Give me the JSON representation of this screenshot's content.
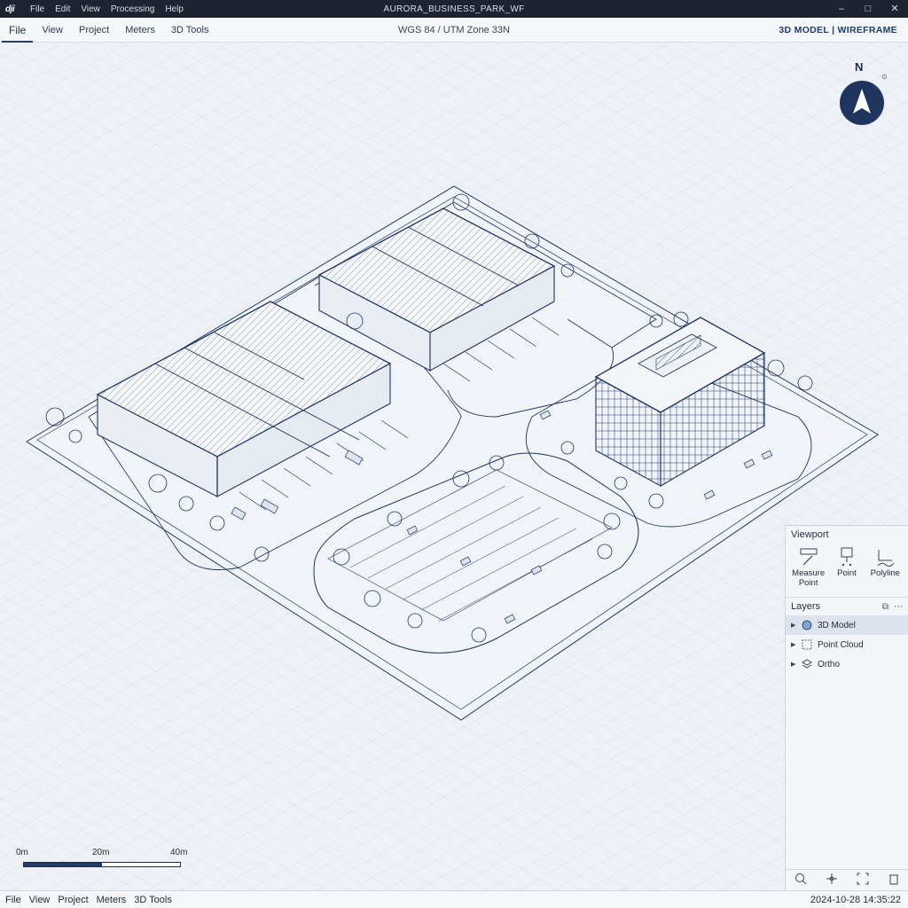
{
  "titlebar": {
    "logo": "dji",
    "menu": [
      "File",
      "Edit",
      "View",
      "Processing",
      "Help"
    ],
    "title": "AURORA_BUSINESS_PARK_WF",
    "controls": [
      "–",
      "□",
      "✕"
    ]
  },
  "toolbar": {
    "tabs": [
      "File",
      "View",
      "Project",
      "Meters",
      "3D Tools"
    ],
    "active_tab": "File",
    "crs": "WGS 84 / UTM Zone 33N",
    "mode": "3D MODEL | WIREFRAME"
  },
  "compass": {
    "north_label": "N",
    "icon": "compass-arrow-icon"
  },
  "scale": {
    "labels": [
      "0m",
      "20m",
      "40m"
    ],
    "fill_fraction": 0.5
  },
  "panel": {
    "viewport_title": "Viewport",
    "tools": [
      {
        "label": "Measure Point",
        "icon": "ruler-pencil-icon"
      },
      {
        "label": "Point",
        "icon": "point-marker-icon"
      },
      {
        "label": "Polyline",
        "icon": "polyline-icon"
      }
    ],
    "layers_title": "Layers",
    "layers": [
      {
        "label": "3D Model",
        "icon": "mesh-icon",
        "selected": true
      },
      {
        "label": "Point Cloud",
        "icon": "point-cloud-icon",
        "selected": false
      },
      {
        "label": "Ortho",
        "icon": "ortho-layers-icon",
        "selected": false
      }
    ],
    "bottom_icons": [
      "zoom-icon",
      "pan-icon",
      "fit-view-icon",
      "delete-icon"
    ]
  },
  "statusbar": {
    "menu": [
      "File",
      "View",
      "Project",
      "Meters",
      "3D Tools"
    ],
    "timestamp": "2024-10-28 14:35:22"
  },
  "colors": {
    "line": "#1f3560",
    "accent": "#1f3c6d",
    "bg": "#eef1f5"
  }
}
